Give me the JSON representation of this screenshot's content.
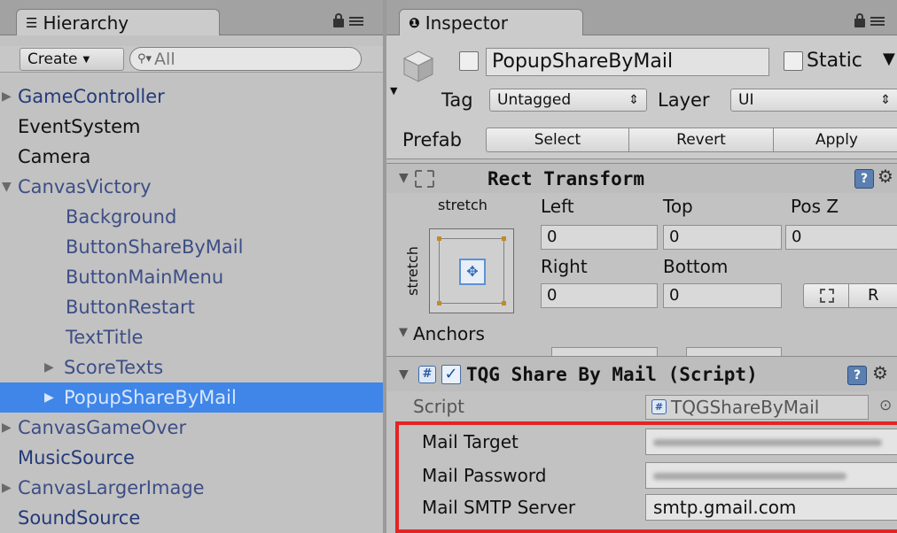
{
  "hierarchy": {
    "tab_label": "Hierarchy",
    "create_label": "Create",
    "search_placeholder": "All",
    "items": [
      {
        "label": "GameController",
        "arrow": "▶",
        "style": "blue"
      },
      {
        "label": "EventSystem",
        "arrow": "",
        "style": "dark"
      },
      {
        "label": "Camera",
        "arrow": "",
        "style": "dark"
      },
      {
        "label": "CanvasVictory",
        "arrow": "▼",
        "style": "child"
      },
      {
        "label": "Background",
        "arrow": "",
        "style": "child"
      },
      {
        "label": "ButtonShareByMail",
        "arrow": "",
        "style": "child"
      },
      {
        "label": "ButtonMainMenu",
        "arrow": "",
        "style": "child"
      },
      {
        "label": "ButtonRestart",
        "arrow": "",
        "style": "child"
      },
      {
        "label": "TextTitle",
        "arrow": "",
        "style": "child"
      },
      {
        "label": "ScoreTexts",
        "arrow": "▶",
        "style": "child"
      },
      {
        "label": "PopupShareByMail",
        "arrow": "▶",
        "style": "selected"
      },
      {
        "label": "CanvasGameOver",
        "arrow": "▶",
        "style": "child"
      },
      {
        "label": "MusicSource",
        "arrow": "",
        "style": "blue"
      },
      {
        "label": "CanvasLargerImage",
        "arrow": "▶",
        "style": "child"
      },
      {
        "label": "SoundSource",
        "arrow": "",
        "style": "blue"
      }
    ]
  },
  "inspector": {
    "tab_label": "Inspector",
    "object_name": "PopupShareByMail",
    "static_label": "Static",
    "tag_label": "Tag",
    "tag_value": "Untagged",
    "layer_label": "Layer",
    "layer_value": "UI",
    "prefab_label": "Prefab",
    "prefab_buttons": [
      "Select",
      "Revert",
      "Apply"
    ],
    "rect_transform": {
      "title": "Rect Transform",
      "stretch_h": "stretch",
      "stretch_v": "stretch",
      "left_label": "Left",
      "top_label": "Top",
      "posz_label": "Pos Z",
      "right_label": "Right",
      "bottom_label": "Bottom",
      "left_value": "0",
      "top_value": "0",
      "posz_value": "0",
      "right_value": "0",
      "bottom_value": "0",
      "r_label": "R",
      "anchors_label": "Anchors"
    },
    "script_component": {
      "title": "TQG Share By Mail (Script)",
      "script_label": "Script",
      "script_value": "TQGShareByMail",
      "fields": [
        {
          "label": "Mail Target",
          "value": ""
        },
        {
          "label": "Mail Password",
          "value": ""
        },
        {
          "label": "Mail SMTP Server",
          "value": "smtp.gmail.com"
        }
      ]
    }
  },
  "colors": {
    "selection": "#3f86e8",
    "highlight_box": "#e32424"
  }
}
